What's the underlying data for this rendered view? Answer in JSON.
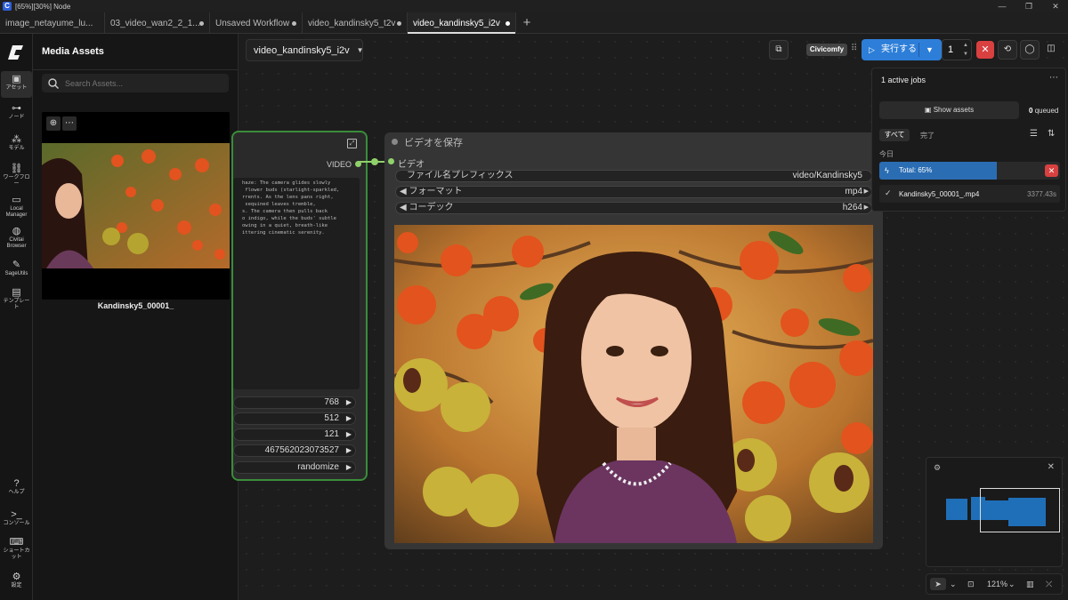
{
  "window": {
    "title": "[65%][30%] Node",
    "app_letter": "C"
  },
  "tabs": [
    {
      "label": "image_netayume_lu..."
    },
    {
      "label": "03_video_wan2_2_1..."
    },
    {
      "label": "Unsaved Workflow"
    },
    {
      "label": "video_kandinsky5_t2v"
    },
    {
      "label": "video_kandinsky5_i2v"
    }
  ],
  "rail": {
    "assets": "アセット",
    "nodes": "ノード",
    "models": "モデル",
    "workflows": "ワークフロー",
    "local_manager": "Local Manager",
    "civitai_browser": "Civitai Browser",
    "sageutils": "SageUtils",
    "templates": "テンプレート",
    "help": "ヘルプ",
    "console": "コンソール",
    "shortcuts": "ショートカット",
    "settings": "設定"
  },
  "media": {
    "title": "Media Assets",
    "search_placeholder": "Search Assets...",
    "item_name": "Kandinsky5_00001_"
  },
  "workflow": {
    "name": "video_kandinsky5_i2v"
  },
  "node_left": {
    "output_label": "VIDEO",
    "prompt_text": "haze: The camera glides slowly\n flower buds (starlight-sparkled,\nrrents. As the lens pans right,\n sequined leaves tremble,\ns. The camera then pulls back\no indigo, while the buds' subtle\nowing in a quiet, breath-like\nittering cinematic serenity.",
    "values": [
      "768",
      "512",
      "121",
      "467562023073527",
      "randomize"
    ]
  },
  "node_save": {
    "title": "ビデオを保存",
    "input_label": "ビデオ",
    "widgets": [
      {
        "label": "ファイル名プレフィックス",
        "value": "video/Kandinsky5"
      },
      {
        "label": "◀ フォーマット",
        "value": "mp4"
      },
      {
        "label": "◀ コーデック",
        "value": "h264"
      }
    ]
  },
  "toolbar": {
    "civicomfy": "Civicomfy",
    "run_label": "実行する",
    "batch_count": "1"
  },
  "jobs": {
    "title": "1 active jobs",
    "show_assets": "Show assets",
    "queued_count": "0",
    "queued_label": "queued",
    "filter_all": "すべて",
    "filter_done": "完了",
    "today": "今日",
    "progress_label": "Total: 65%",
    "progress_value": 0.65,
    "done_file": "Kandinsky5_00001_.mp4",
    "done_time": "3377.43s"
  },
  "zoom": {
    "level": "121%"
  },
  "colors": {
    "accent": "#2d7ed8",
    "stop": "#d94040",
    "link": "#8fd16a",
    "node_border": "#3a8d3a"
  }
}
